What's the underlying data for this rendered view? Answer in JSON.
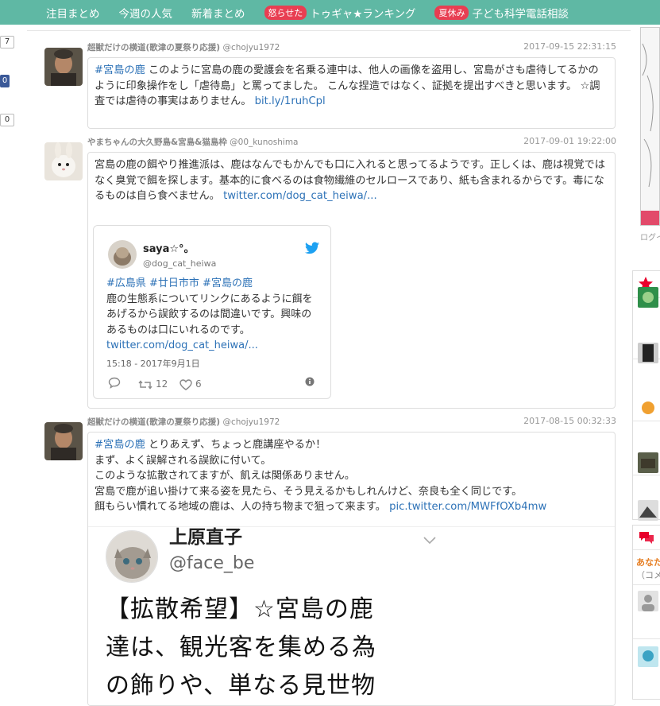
{
  "nav": {
    "items": [
      {
        "label": "注目まとめ"
      },
      {
        "label": "今週の人気"
      },
      {
        "label": "新着まとめ"
      },
      {
        "badge": "怒らせた",
        "label": "トゥギャ★ランキング"
      },
      {
        "badge": "夏休み",
        "label": "子ども科学電話相談"
      }
    ]
  },
  "share": {
    "count_top": "7",
    "count_fb": "0",
    "count_bottom": "0"
  },
  "entries": [
    {
      "user_name": "超獣だけの横道(歌津の夏祭り応援)",
      "handle": "@chojyu1972",
      "time": "2017-09-15 22:31:15",
      "tag": "#宮島の鹿",
      "text": "このように宮島の鹿の愛護会を名乗る連中は、他人の画像を盗用し、宮島がさも虐待してるかのように印象操作をし「虐待島」と罵ってました。 こんな捏造ではなく、証拠を提出すべきと思います。 ☆調査では虐待の事実はありません。",
      "link": "bit.ly/1ruhCpl"
    },
    {
      "user_name": "やまちゃんの大久野島&宮島&猫島枠",
      "handle": "@00_kunoshima",
      "time": "2017-09-01 19:22:00",
      "text": "宮島の鹿の餌やり推進派は、鹿はなんでもかんでも口に入れると思ってるようです。正しくは、鹿は視覚ではなく臭覚で餌を探します。基本的に食べるのは食物繊維のセルロースであり、紙も含まれるからです。毒になるものは自ら食べません。",
      "link": "twitter.com/dog_cat_heiwa/...",
      "embed": {
        "name": "saya☆°。",
        "handle": "@dog_cat_heiwa",
        "tags": "#広島県 #廿日市市 #宮島の鹿",
        "text": "鹿の生態系についてリンクにあるように餌をあげるから誤飲するのは間違いです。興味のあるものは口にいれるのです。",
        "link": "twitter.com/dog_cat_heiwa/...",
        "time": "15:18 - 2017年9月1日",
        "retweets": "12",
        "likes": "6"
      }
    },
    {
      "user_name": "超獣だけの横道(歌津の夏祭り応援)",
      "handle": "@chojyu1972",
      "time": "2017-08-15 00:32:33",
      "tag": "#宮島の鹿",
      "line1": "とりあえず、ちょっと鹿講座やるか！",
      "line2": "まず、よく誤解される誤飲に付いて。",
      "line3": "このような拡散されてますが、飢えは関係ありません。",
      "line4": "宮島で鹿が追い掛けて来る姿を見たら、そう見えるかもしれんけど、奈良も全く同じです。",
      "line5": "餌もらい慣れてる地域の鹿は、人の持ち物まで狙って来ます。",
      "link": "pic.twitter.com/MWFfOXb4mw",
      "image": {
        "name": "上原直子",
        "handle": "@face_be",
        "line1": "【拡散希望】☆宮島の鹿",
        "line2": "達は、観光客を集める為",
        "line3": "の飾りや、単なる見世物"
      }
    }
  ],
  "sidebar": {
    "login": "ログイ",
    "comment_label": "あなた",
    "comment_sub": "（コメ"
  },
  "colors": {
    "nav_bg": "#5fb8a4",
    "badge": "#e83e52",
    "link": "#2d72b7"
  }
}
